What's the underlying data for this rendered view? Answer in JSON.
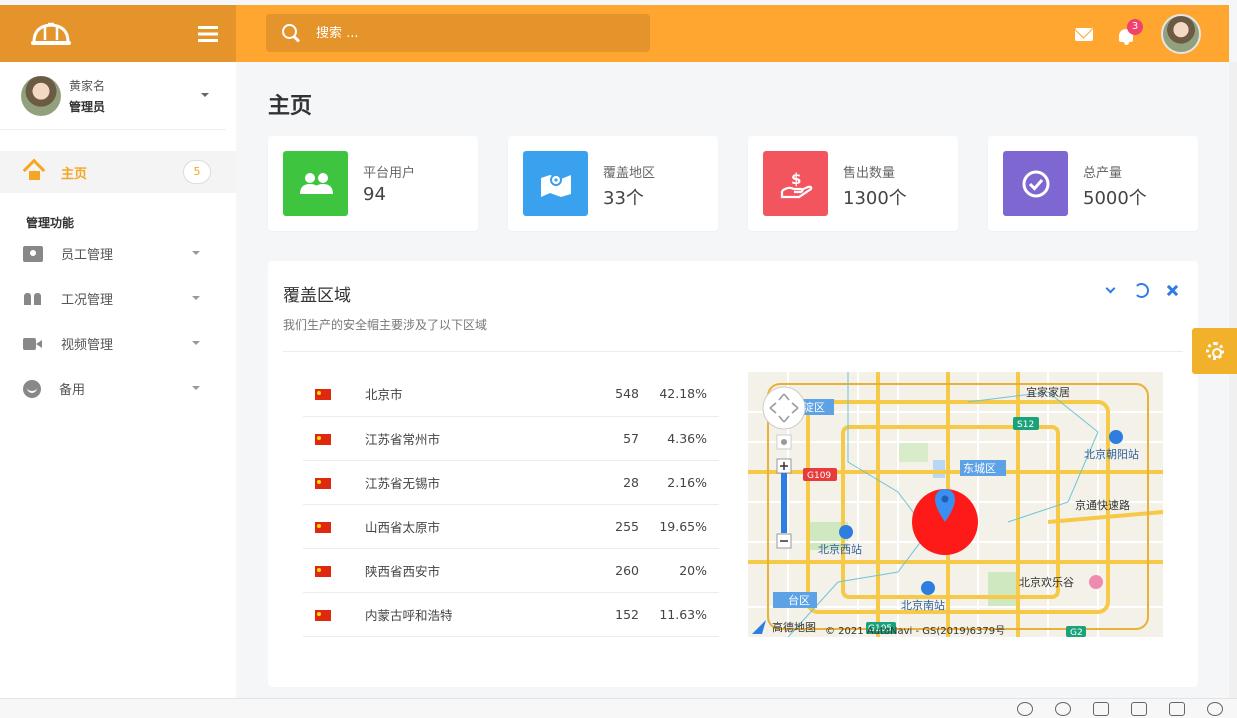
{
  "app": {
    "colors": {
      "accent": "#f5a623",
      "topbar": "#ffa630",
      "logo_bg": "#e5932b",
      "link": "#2e7de1"
    },
    "logo_icon": "hard-hat-icon",
    "menu_icon": "hamburger-icon"
  },
  "header": {
    "search_placeholder": "搜索 ...",
    "notification_count": "3"
  },
  "sidebar": {
    "user": {
      "name": "黄家名",
      "role": "管理员"
    },
    "home": {
      "label": "主页",
      "badge": "5"
    },
    "section_title": "管理功能",
    "items": [
      {
        "label": "员工管理",
        "icon": "id-badge-icon"
      },
      {
        "label": "工况管理",
        "icon": "people-icon"
      },
      {
        "label": "视频管理",
        "icon": "video-icon"
      },
      {
        "label": "备用",
        "icon": "smile-icon"
      }
    ]
  },
  "page": {
    "title": "主页",
    "stats": [
      {
        "label": "平台用户",
        "value": "94",
        "color": "#3ec43e",
        "icon": "users-icon"
      },
      {
        "label": "覆盖地区",
        "value": "33个",
        "color": "#3aa1ef",
        "icon": "map-marker-icon"
      },
      {
        "label": "售出数量",
        "value": "1300个",
        "color": "#f3555f",
        "icon": "hand-dollar-icon"
      },
      {
        "label": "总产量",
        "value": "5000个",
        "color": "#7e67d0",
        "icon": "check-circle-icon"
      }
    ],
    "panel": {
      "title": "覆盖区域",
      "subtitle": "我们生产的安全帽主要涉及了以下区域",
      "rows": [
        {
          "name": "北京市",
          "count": "548",
          "percent": "42.18%"
        },
        {
          "name": "江苏省常州市",
          "count": "57",
          "percent": "4.36%"
        },
        {
          "name": "江苏省无锡市",
          "count": "28",
          "percent": "2.16%"
        },
        {
          "name": "山西省太原市",
          "count": "255",
          "percent": "19.65%"
        },
        {
          "name": "陕西省西安市",
          "count": "260",
          "percent": "20%"
        },
        {
          "name": "内蒙古呼和浩特",
          "count": "152",
          "percent": "11.63%"
        }
      ]
    },
    "map": {
      "labels": {
        "yijiajiaju": "宜家家居",
        "s12": "S12",
        "chaoyang_station": "北京朝阳站",
        "g109": "G109",
        "dongcheng": "东城区",
        "jingtong": "京通快速路",
        "xicheng_frag": "淀区",
        "beijing_west": "北京西站",
        "beijing_south": "北京南站",
        "happy_valley": "北京欢乐谷",
        "fengtai_frag": "台区",
        "brand": "高德地图",
        "copyright": "© 2021 AutoNavi - GS(2019)6379号",
        "g105": "G105",
        "g2": "G2"
      }
    }
  }
}
